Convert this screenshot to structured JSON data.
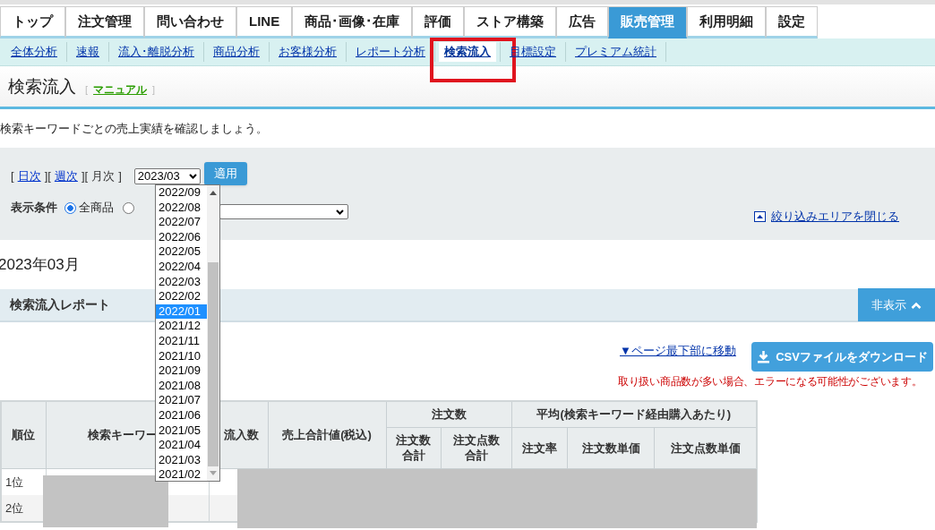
{
  "tabs": [
    {
      "label": "トップ",
      "selected": false
    },
    {
      "label": "注文管理",
      "selected": false
    },
    {
      "label": "問い合わせ",
      "selected": false
    },
    {
      "label": "LINE",
      "selected": false
    },
    {
      "label": "商品･画像･在庫",
      "selected": false
    },
    {
      "label": "評価",
      "selected": false
    },
    {
      "label": "ストア構築",
      "selected": false
    },
    {
      "label": "広告",
      "selected": false
    },
    {
      "label": "販売管理",
      "selected": true
    },
    {
      "label": "利用明細",
      "selected": false
    },
    {
      "label": "設定",
      "selected": false
    }
  ],
  "subnav": [
    {
      "label": "全体分析",
      "selected": false
    },
    {
      "label": "速報",
      "selected": false
    },
    {
      "label": "流入･離脱分析",
      "selected": false
    },
    {
      "label": "商品分析",
      "selected": false
    },
    {
      "label": "お客様分析",
      "selected": false
    },
    {
      "label": "レポート分析",
      "selected": false
    },
    {
      "label": "検索流入",
      "selected": true,
      "highlighted": true
    },
    {
      "label": "目標設定",
      "selected": false
    },
    {
      "label": "プレミアム統計",
      "selected": false
    }
  ],
  "page_title": "検索流入",
  "manual_link": "マニュアル",
  "manual_open": "[",
  "manual_close": "]",
  "description": "検索キーワードごとの売上実績を確認しましょう。",
  "filter": {
    "periods": [
      {
        "open": "[",
        "label": "日次",
        "close": "]",
        "selected": false
      },
      {
        "open": "[",
        "label": "週次",
        "close": "]",
        "selected": false
      },
      {
        "open": "[",
        "label": "月次",
        "close": "]",
        "selected": true
      }
    ],
    "month_select": "2023/03",
    "apply_button": "適用",
    "condition_label": "表示条件",
    "radios": [
      {
        "label": "全商品",
        "selected": true
      },
      {
        "selected": false
      }
    ],
    "close_link": "絞り込みエリアを閉じる"
  },
  "month_heading": "2023年03月",
  "report": {
    "title": "検索流入レポート",
    "hide_button": "非表示",
    "bottom_link": "▼ページ最下部に移動",
    "csv_button": "CSVファイルをダウンロード",
    "note": "取り扱い商品数が多い場合、エラーになる可能性がございます。"
  },
  "table": {
    "columns": [
      {
        "label": "順位"
      },
      {
        "label": "検索キーワー"
      },
      {
        "label": "流入数"
      },
      {
        "label": "売上合計値(税込)"
      },
      {
        "label": "注文数",
        "children": [
          {
            "label": "注文数合計",
            "wrap": true
          },
          {
            "label": "注文点数合計",
            "wrap": true
          }
        ]
      },
      {
        "label": "平均(検索キーワード経由購入あたり)",
        "children": [
          {
            "label": "注文率"
          },
          {
            "label": "注文数単価"
          },
          {
            "label": "注文点数単価"
          }
        ]
      }
    ],
    "rows": [
      {
        "rank": "1位"
      },
      {
        "rank": "2位"
      }
    ]
  },
  "dropdown": {
    "options": [
      {
        "label": "2022/09",
        "selected": false
      },
      {
        "label": "2022/08",
        "selected": false
      },
      {
        "label": "2022/07",
        "selected": false
      },
      {
        "label": "2022/06",
        "selected": false
      },
      {
        "label": "2022/05",
        "selected": false
      },
      {
        "label": "2022/04",
        "selected": false
      },
      {
        "label": "2022/03",
        "selected": false
      },
      {
        "label": "2022/02",
        "selected": false
      },
      {
        "label": "2022/01",
        "selected": true
      },
      {
        "label": "2021/12",
        "selected": false
      },
      {
        "label": "2021/11",
        "selected": false
      },
      {
        "label": "2021/10",
        "selected": false
      },
      {
        "label": "2021/09",
        "selected": false
      },
      {
        "label": "2021/08",
        "selected": false
      },
      {
        "label": "2021/07",
        "selected": false
      },
      {
        "label": "2021/06",
        "selected": false
      },
      {
        "label": "2021/05",
        "selected": false
      },
      {
        "label": "2021/04",
        "selected": false
      },
      {
        "label": "2021/03",
        "selected": false
      },
      {
        "label": "2021/02",
        "selected": false
      }
    ]
  }
}
